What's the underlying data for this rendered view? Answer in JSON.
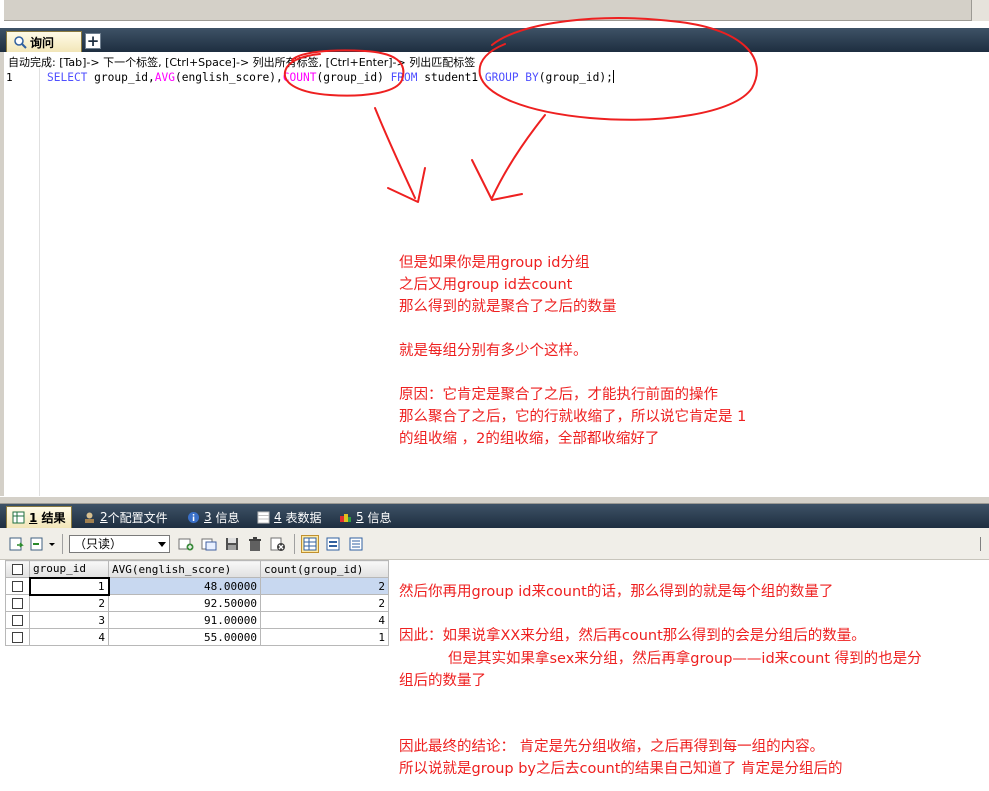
{
  "editor": {
    "tab_label": "询问",
    "add_tab_label": "+",
    "autocomplete_hint": "自动完成: [Tab]-> 下一个标签, [Ctrl+Space]-> 列出所有标签, [Ctrl+Enter]-> 列出匹配标签",
    "line_number": "1",
    "sql": {
      "select": "SELECT",
      "p1": " group_id,",
      "avg": "AVG",
      "p2": "(english_score),",
      "count": "COUNT",
      "p3": "(group_id) ",
      "from": "FROM",
      "p4": " student1 ",
      "group_by": "GROUP BY",
      "p5": "(group_id);"
    }
  },
  "notes_top": [
    "但是如果你是用group id分组",
    "之后又用group id去count",
    "那么得到的就是聚合了之后的数量",
    "",
    "就是每组分别有多少个这样。",
    "",
    "原因：它肯定是聚合了之后，才能执行前面的操作",
    "那么聚合了之后，它的行就收缩了，所以说它肯定是 1",
    "的组收缩 ，2的组收缩，全部都收缩好了"
  ],
  "result_tabs": [
    {
      "num": "1",
      "label": "结果"
    },
    {
      "num": "2",
      "label": "个配置文件"
    },
    {
      "num": "3",
      "label": "信息"
    },
    {
      "num": "4",
      "label": "表数据"
    },
    {
      "num": "5",
      "label": "信息"
    }
  ],
  "toolbar": {
    "readonly_label": "（只读）"
  },
  "grid": {
    "columns": [
      "group_id",
      "AVG(english_score)",
      "count(group_id)"
    ],
    "rows": [
      [
        "1",
        "48.00000",
        "2"
      ],
      [
        "2",
        "92.50000",
        "2"
      ],
      [
        "3",
        "91.00000",
        "4"
      ],
      [
        "4",
        "55.00000",
        "1"
      ]
    ]
  },
  "notes_bottom": {
    "n1": "然后你再用group id来count的话，那么得到的就是每个组的数量了",
    "n2": "因此：如果说拿XX来分组，然后再count那么得到的会是分组后的数量。",
    "n3": "但是其实如果拿sex来分组，然后再拿group——id来count  得到的也是分",
    "n4": "组后的数量了",
    "n5": "因此最终的结论：    肯定是先分组收缩，之后再得到每一组的内容。",
    "n6": "所以说就是group by之后去count的结果自己知道了 肯定是分组后的"
  },
  "colors": {
    "annotation": "#ee2020",
    "keyword": "#5050ff",
    "function": "#ff00ff",
    "tab_bar": "#1e2e40"
  }
}
